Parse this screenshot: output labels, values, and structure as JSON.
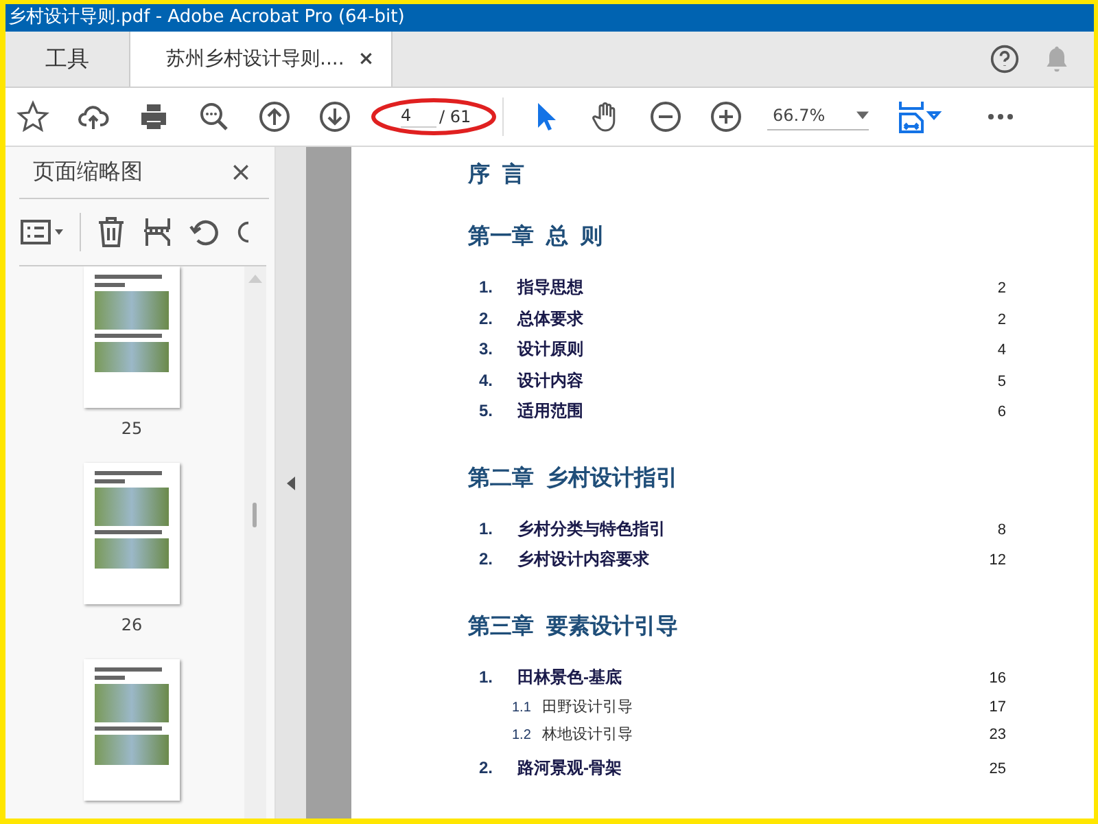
{
  "window": {
    "title": "乡村设计导则.pdf - Adobe Acrobat Pro (64-bit)"
  },
  "tabs": [
    {
      "label": "工具",
      "selected": false
    },
    {
      "label": "苏州乡村设计导则....",
      "selected": true,
      "close": "×"
    }
  ],
  "toolbar": {
    "page": "4",
    "total": "/ 61",
    "zoom": "66.7%"
  },
  "sidebar": {
    "title": "页面缩略图",
    "thumbnails": [
      {
        "label": "25",
        "selected": false
      },
      {
        "label": "26",
        "selected": false
      },
      {
        "selected": false
      }
    ]
  },
  "toc": [
    {
      "kind": "heading",
      "text": "序  言"
    },
    {
      "kind": "heading",
      "text": "第一章  总  则"
    },
    {
      "kind": "item",
      "num": "1.",
      "text": "指导思想",
      "page": "2"
    },
    {
      "kind": "item",
      "num": "2.",
      "text": "总体要求",
      "page": "2"
    },
    {
      "kind": "item",
      "num": "3.",
      "text": "设计原则",
      "page": "4"
    },
    {
      "kind": "item",
      "num": "4.",
      "text": "设计内容",
      "page": "5"
    },
    {
      "kind": "item",
      "num": "5.",
      "text": "适用范围",
      "page": "6"
    },
    {
      "kind": "heading",
      "text": "第二章  乡村设计指引"
    },
    {
      "kind": "item",
      "num": "1.",
      "text": "乡村分类与特色指引",
      "page": "8"
    },
    {
      "kind": "item",
      "num": "2.",
      "text": "乡村设计内容要求",
      "page": "12"
    },
    {
      "kind": "heading",
      "text": "第三章  要素设计引导"
    },
    {
      "kind": "item",
      "num": "1.",
      "text": "田林景色-基底",
      "page": "16"
    },
    {
      "kind": "sub",
      "num": "1.1",
      "text": "田野设计引导",
      "page": "17"
    },
    {
      "kind": "sub",
      "num": "1.2",
      "text": "林地设计引导",
      "page": "23"
    },
    {
      "kind": "item",
      "num": "2.",
      "text": "路河景观-骨架",
      "page": "25"
    }
  ]
}
